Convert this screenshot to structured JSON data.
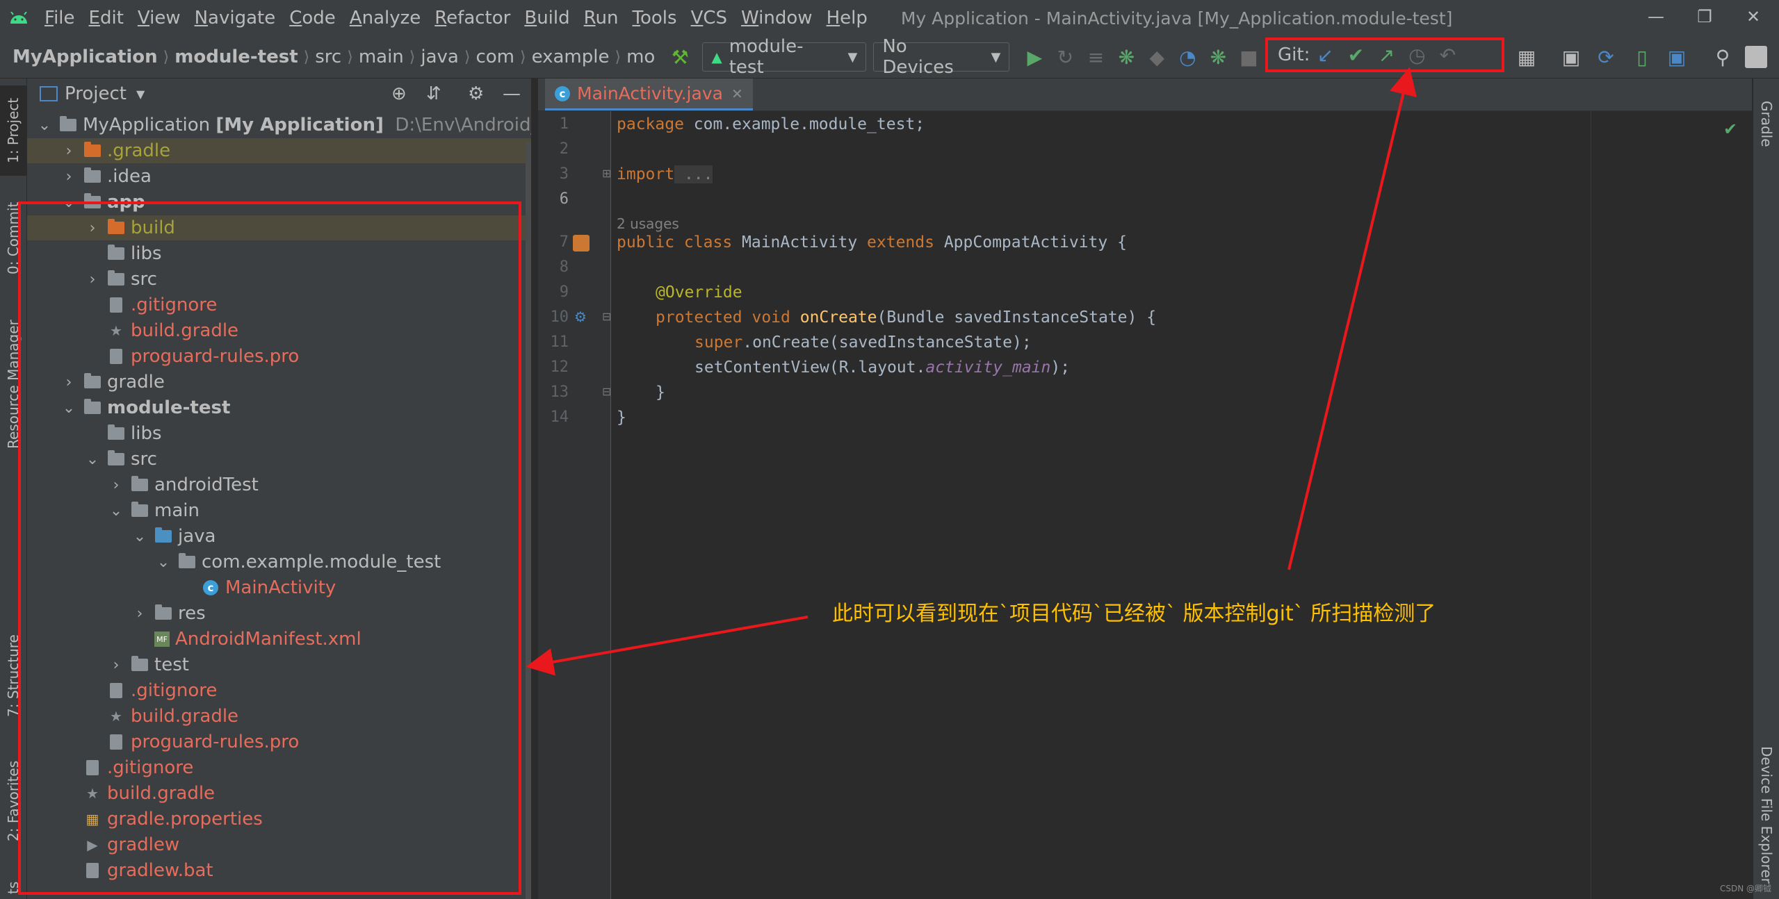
{
  "menu": [
    "File",
    "Edit",
    "View",
    "Navigate",
    "Code",
    "Analyze",
    "Refactor",
    "Build",
    "Run",
    "Tools",
    "VCS",
    "Window",
    "Help"
  ],
  "window_title": "My Application - MainActivity.java [My_Application.module-test]",
  "breadcrumb": [
    "MyApplication",
    "module-test",
    "src",
    "main",
    "java",
    "com",
    "example",
    "mo"
  ],
  "run_config": "module-test",
  "device": "No Devices",
  "git_label": "Git:",
  "project_header": "Project",
  "editor_tab": "MainActivity.java",
  "left_tabs": {
    "project": "1: Project",
    "commit": "0: Commit",
    "resource": "Resource Manager",
    "structure": "7: Structure",
    "favorites": "2: Favorites",
    "build_variants": "ts"
  },
  "right_tabs": {
    "gradle": "Gradle",
    "device_explorer": "Device File Explorer"
  },
  "tree": [
    {
      "label": "MyApplication",
      "suffix": "[My Application]",
      "path": "D:\\Env\\Android_Projec"
    },
    {
      "label": ".gradle"
    },
    {
      "label": ".idea"
    },
    {
      "label": "app"
    },
    {
      "label": "build"
    },
    {
      "label": "libs"
    },
    {
      "label": "src"
    },
    {
      "label": ".gitignore"
    },
    {
      "label": "build.gradle"
    },
    {
      "label": "proguard-rules.pro"
    },
    {
      "label": "gradle"
    },
    {
      "label": "module-test"
    },
    {
      "label": "libs"
    },
    {
      "label": "src"
    },
    {
      "label": "androidTest"
    },
    {
      "label": "main"
    },
    {
      "label": "java"
    },
    {
      "label": "com.example.module_test"
    },
    {
      "label": "MainActivity"
    },
    {
      "label": "res"
    },
    {
      "label": "AndroidManifest.xml"
    },
    {
      "label": "test"
    },
    {
      "label": ".gitignore"
    },
    {
      "label": "build.gradle"
    },
    {
      "label": "proguard-rules.pro"
    },
    {
      "label": ".gitignore"
    },
    {
      "label": "build.gradle"
    },
    {
      "label": "gradle.properties"
    },
    {
      "label": "gradlew"
    },
    {
      "label": "gradlew.bat"
    }
  ],
  "code": {
    "line_numbers": [
      "1",
      "2",
      "3",
      "6",
      "7",
      "8",
      "9",
      "10",
      "11",
      "12",
      "13",
      "14"
    ],
    "usages": "2 usages",
    "l1_kw": "package",
    "l1_rest": " com.example.module_test;",
    "l3_kw": "import",
    "l3_rest": " ...",
    "l7_kw1": "public class",
    "l7_name": " MainActivity ",
    "l7_kw2": "extends",
    "l7_rest": " AppCompatActivity {",
    "l9": "@Override",
    "l10_kw": "protected void",
    "l10_fn": " onCreate",
    "l10_rest": "(Bundle savedInstanceState) {",
    "l11_kw": "super",
    "l11_rest": ".onCreate(savedInstanceState);",
    "l12_a": "setContentView(R.layout.",
    "l12_fld": "activity_main",
    "l12_b": ");",
    "l13": "}",
    "l14": "}"
  },
  "annotation": "此时可以看到现在`项目代码`已经被` 版本控制git` 所扫描检测了",
  "watermark": "CSDN @卿钺",
  "colors": {
    "annotation_red": "#e8181c",
    "annotation_text": "#ffc000",
    "untracked_red": "#e66d5c",
    "ignored_olive": "#a6a33a"
  }
}
